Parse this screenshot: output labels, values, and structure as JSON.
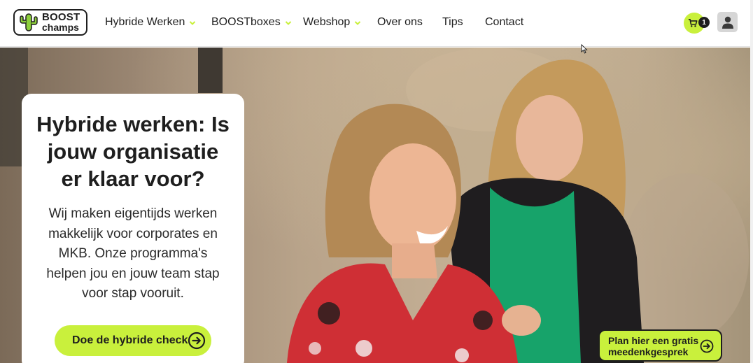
{
  "header": {
    "logo": {
      "line1": "BOOST",
      "line2": "champs"
    },
    "nav": [
      {
        "label": "Hybride Werken",
        "dropdown": true
      },
      {
        "label": "BOOSTboxes",
        "dropdown": true
      },
      {
        "label": "Webshop",
        "dropdown": true
      },
      {
        "label": "Over ons",
        "dropdown": false
      },
      {
        "label": "Tips",
        "dropdown": false
      },
      {
        "label": "Contact",
        "dropdown": false
      }
    ],
    "cart": {
      "icon": "cart-icon",
      "count": "1"
    },
    "account": {
      "icon": "user-icon"
    }
  },
  "hero": {
    "title": "Hybride werken: Is jouw organisatie er klaar voor?",
    "text": "Wij maken eigentijds werken makkelijk voor corporates en MKB. Onze programma's helpen jou en jouw team stap voor stap vooruit.",
    "cta_label": "Doe de hybride check",
    "cta_icon": "arrow-right-circle-icon"
  },
  "floating_cta": {
    "label": "Plan hier een gratis meedenkgesprek",
    "icon": "arrow-right-circle-icon"
  },
  "colors": {
    "accent": "#c9f03c",
    "dark": "#1e1e1e",
    "logo_green": "#8ccf3a"
  }
}
